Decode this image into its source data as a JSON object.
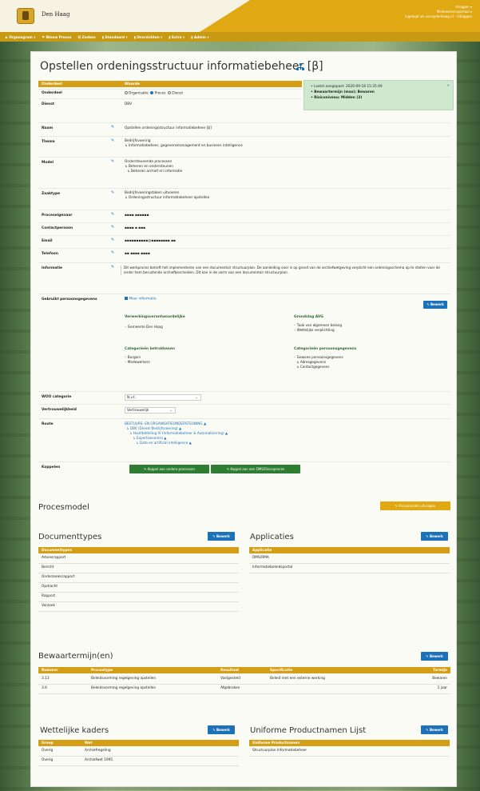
{
  "header": {
    "brand": "Den Haag",
    "user_lines": [
      "Inloggen ▾",
      "Medewerkersportaal ▾",
      "Ingelogd als user@denhaag.nl - Uitloggen"
    ]
  },
  "nav": [
    "♟ Organogram ▾",
    "⚑ Nieuw Proces",
    "Q Zoeken",
    "▮ Standaard ▾",
    "▮ Overzichten ▾",
    "▮ Extra ▾",
    "▮ Admin ▾"
  ],
  "page": {
    "title": "Opstellen ordeningsstructuur informatiebeheer [β]"
  },
  "status": {
    "close": "×",
    "lines": [
      "• Laatst aangepast: 2020-09-18 15:35:49",
      "• Bewaartermijn (max): Bewaren",
      "• Risiconiveau: Midden (3)"
    ]
  },
  "table_header": {
    "col1": "Onderdeel",
    "col2": "Waarde"
  },
  "rows": {
    "onderdeel": {
      "label": "Onderdeel",
      "opt1": "Organisatie",
      "opt2": "Proces",
      "opt3": "Dienst"
    },
    "dienst": {
      "label": "Dienst",
      "value": "DBV"
    },
    "naam": {
      "label": "Naam",
      "value": "Opstellen ordeningsstructuur informatiebeheer [β]"
    },
    "thema": {
      "label": "Thema",
      "v1": "Bedrijfsvoering",
      "v2": "↳ Informatiebeheer, gegevensmanagement en business intelligence"
    },
    "model": {
      "label": "Model",
      "v1": "Ondersteunende processen",
      "v2": "↳ Beheren en ondersteunen",
      "v3": "↳ Beheren archief en informatie"
    },
    "zaaktype": {
      "label": "Zaaktype",
      "v1": "Bedrijfsvoeringstaken uitvoeren",
      "v2": "↳ Ordeningsstructuur informatiebeheer opstellen"
    },
    "proceseigenaar": {
      "label": "Proceseigenaar",
      "value": "▪▪▪▪ ▪▪▪▪▪▪"
    },
    "contactpersoon": {
      "label": "Contactpersoon",
      "value": "▪▪▪▪ ▪ ▪▪▪"
    },
    "email": {
      "label": "Email",
      "value": "▪▪▪▪▪▪▪▪▪▪@▪▪▪▪▪▪▪▪.▪▪"
    },
    "telefoon": {
      "label": "Telefoon",
      "value": "▪▪ ▪▪▪▪ ▪▪▪▪"
    },
    "informatie": {
      "label": "Informatie",
      "value": "Dit werkproces betreft het implementeren van een documentair structuurplan. De aanleiding voor is op grond van de archiefwetgeving verplicht een ordeningsschema op te stellen voor de onder hem berustende archiefbescheiden. Dit kan in de vorm van een documentair structuurplan."
    },
    "persoonsgegevens": {
      "label": "Gebruikt persoonsgegevens",
      "checkbox": "Meer informatie",
      "button": "✎ Bewerk",
      "verwerking_h": "Verwerkingsverantwoordelijke",
      "verwerking_v": "◦ Gemeente Den Haag",
      "grondslag_h": "Grondslag AVG",
      "grondslag_v1": "◦ Taak van algemeen belang",
      "grondslag_v2": "◦ Wettelijke verplichting",
      "betrokkenen_h": "Categorieën betrokkenen",
      "betrokkenen_v1": "◦ Burgers",
      "betrokkenen_v2": "◦ Medewerkers",
      "categorie_h": "Categorieën persoonsgegevens",
      "categorie_v1": "◦ Gewone persoonsgegevens",
      "categorie_v2": "↳ Adresgegevens",
      "categorie_v3": "↳ Contactgegevens"
    },
    "woo": {
      "label": "WOO categorie",
      "value": "N.v.t."
    },
    "vertrouwelijkheid": {
      "label": "Vertrouwelijkheid",
      "value": "Vertrouwelijk"
    },
    "route": {
      "label": "Route",
      "l1": "BESTUURS- EN ORGANISATIEONDERSTEUNING ▲",
      "l2": "↳ DBV (Dienst Bedrijfsvoering) ▲",
      "l3": "↳ Hoofdafdeling IV (Informatiebeheer & Automatisering) ▲",
      "l4": "↳ Expertisecentra ▲",
      "l5": "↳ Data en artificial intelligence ▲"
    },
    "koppelen": {
      "label": "Koppelen",
      "btn1": "✎ Koppel aan andere processen",
      "btn2": "✎ Koppel aan een DMS/Risicoproces"
    }
  },
  "procesmodel": {
    "title": "Procesmodel",
    "button": "✎ Procesmodel uitvragen"
  },
  "documenttypes": {
    "title": "Documenttypes",
    "button": "✎ Bewerk",
    "header": "Documenttypes",
    "items": [
      "Adviesrapport",
      "Bericht",
      "Onderzoeksrapport",
      "Opdracht",
      "Rapport",
      "Verzoek"
    ]
  },
  "applicaties": {
    "title": "Applicaties",
    "button": "✎ Bewerk",
    "header": "Applicatie",
    "items": [
      "DMS/RMA",
      "Informatiebeleidsportal"
    ]
  },
  "bewaartermijnen": {
    "title": "Bewaartermijn(en)",
    "button": "✎ Bewerk",
    "headers": [
      "Nummer",
      "Procestype",
      "Resultaat",
      "Specificatie",
      "Termijn"
    ],
    "rows": [
      [
        "3.13",
        "Beleidsvorming regelgeving opstellen",
        "Vastgesteld",
        "Beleid met een externe werking",
        "Bewaren"
      ],
      [
        "3.6",
        "Beleidsvorming regelgeving opstellen",
        "Afgebroken",
        "",
        "1 jaar"
      ]
    ]
  },
  "wettelijke": {
    "title": "Wettelijke kaders",
    "button": "✎ Bewerk",
    "headers": [
      "Groep",
      "Wet"
    ],
    "rows": [
      [
        "Overig",
        "Archiefregeling"
      ],
      [
        "Overig",
        "Archiefwet 1995"
      ]
    ]
  },
  "productnamen": {
    "title": "Uniforme Productnamen Lijst",
    "button": "✎ Bewerk",
    "header": "Uniforme Productnamen",
    "items": [
      "Structuurplan Informatiebeheer"
    ]
  }
}
